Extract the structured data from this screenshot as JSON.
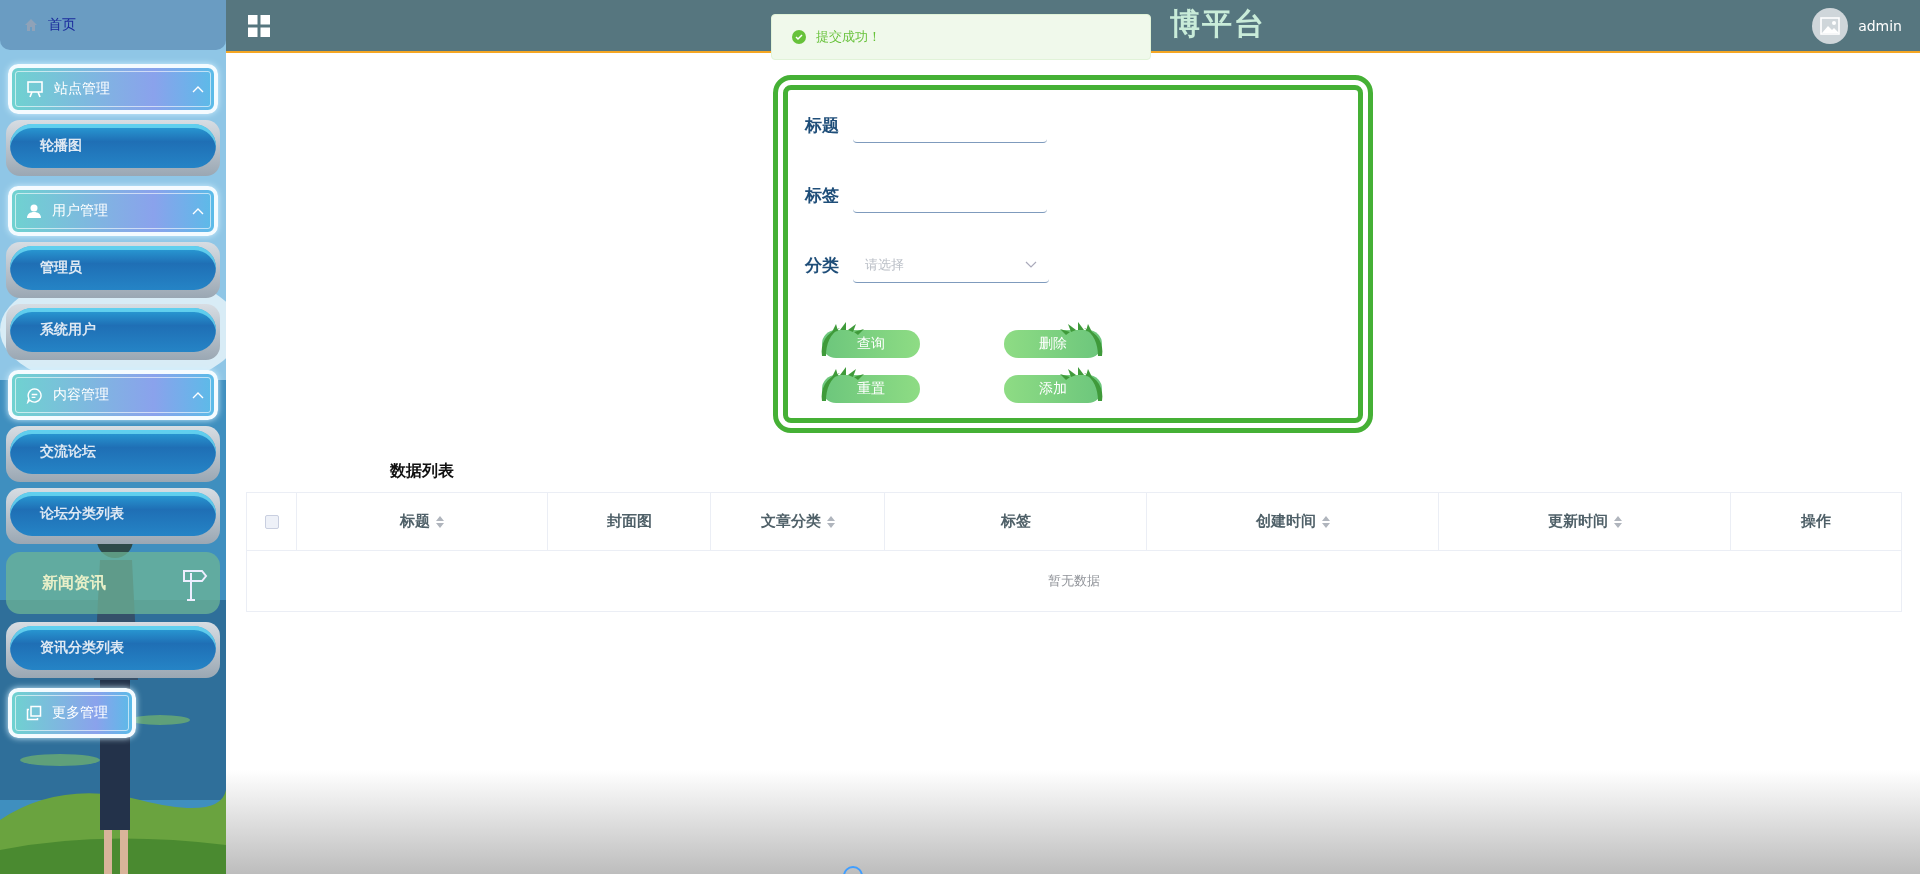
{
  "sidebar": {
    "items": [
      {
        "kind": "home",
        "label": "首页",
        "selected": true
      },
      {
        "kind": "group",
        "label": "站点管理",
        "expanded": true,
        "children": [
          {
            "kind": "pill",
            "label": "轮播图"
          }
        ]
      },
      {
        "kind": "group",
        "label": "用户管理",
        "expanded": true,
        "children": [
          {
            "kind": "pill",
            "label": "管理员"
          },
          {
            "kind": "pill",
            "label": "系统用户"
          }
        ]
      },
      {
        "kind": "group",
        "label": "内容管理",
        "expanded": true,
        "children": [
          {
            "kind": "pill",
            "label": "交流论坛"
          },
          {
            "kind": "pill",
            "label": "论坛分类列表"
          },
          {
            "kind": "banner",
            "label": "新闻资讯"
          },
          {
            "kind": "pill",
            "label": "资讯分类列表"
          }
        ]
      },
      {
        "kind": "group",
        "label": "更多管理",
        "expanded": false
      }
    ]
  },
  "header": {
    "title": "博平台",
    "user": "admin"
  },
  "toast": {
    "message": "提交成功！"
  },
  "search_form": {
    "fields": [
      {
        "kind": "text",
        "label": "标题"
      },
      {
        "kind": "text",
        "label": "标签"
      },
      {
        "kind": "select",
        "label": "分类",
        "placeholder": "请选择"
      }
    ],
    "buttons": [
      "查询",
      "删除",
      "重置",
      "添加"
    ]
  },
  "table": {
    "title": "数据列表",
    "select_all": {
      "checked": false
    },
    "columns": [
      {
        "label": "标题",
        "sortable": true
      },
      {
        "label": "封面图",
        "sortable": false
      },
      {
        "label": "文章分类",
        "sortable": true
      },
      {
        "label": "标签",
        "sortable": false
      },
      {
        "label": "创建时间",
        "sortable": true
      },
      {
        "label": "更新时间",
        "sortable": true
      },
      {
        "label": "操作",
        "sortable": false
      }
    ],
    "empty_text": "暂无数据"
  }
}
